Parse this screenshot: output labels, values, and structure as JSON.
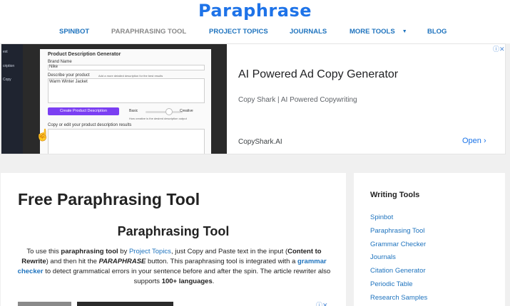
{
  "header": {
    "logo": "Paraphrase",
    "nav": [
      {
        "label": "SPINBOT"
      },
      {
        "label": "PARAPHRASING TOOL"
      },
      {
        "label": "PROJECT TOPICS"
      },
      {
        "label": "JOURNALS"
      },
      {
        "label": "MORE TOOLS"
      },
      {
        "label": "BLOG"
      }
    ]
  },
  "ad_banner": {
    "screenshot": {
      "sidebar_items": [
        "ext",
        "cription",
        "Copy"
      ],
      "panel_title": "Product Description Generator",
      "brand_label": "Brand Name",
      "brand_value": "Nike",
      "describe_label": "Describe your product",
      "describe_hint": "Add a more detailed description for the best results",
      "describe_value": "Warm Winter Jacket",
      "button_label": "Create Product Description",
      "basic_label": "Basic",
      "creative_label": "Creative",
      "slider_hint": "How creative is the desired description output",
      "output_label": "Copy or edit your product description results"
    },
    "title": "AI Powered Ad Copy Generator",
    "subtitle": "Copy Shark | AI Powered Copywriting",
    "domain": "CopyShark.AI",
    "open_label": "Open",
    "info_icon": "adchoices-info-close-icon"
  },
  "article": {
    "title": "Free Paraphrasing Tool",
    "heading": "Paraphrasing Tool",
    "intro": {
      "p1": "To use this ",
      "b1": "paraphrasing tool",
      "p2": " by ",
      "link1": "Project Topics",
      "p3": ", just Copy and Paste text in the input (",
      "b2": "Content to Rewrite",
      "p4": ") and then hit the ",
      "i1": "PARAPHRASE",
      "p5": " button. This paraphrasing tool is integrated with a ",
      "link2": "grammar checker",
      "p6": " to detect grammatical errors in your sentence before and after the spin. The article rewriter also supports ",
      "b3": "100+ languages",
      "p7": "."
    }
  },
  "sidebar": {
    "title": "Writing Tools",
    "links": [
      {
        "label": "Spinbot"
      },
      {
        "label": "Paraphrasing Tool"
      },
      {
        "label": "Grammar Checker"
      },
      {
        "label": "Journals"
      },
      {
        "label": "Citation Generator"
      },
      {
        "label": "Periodic Table"
      },
      {
        "label": "Research Samples"
      }
    ]
  },
  "colors": {
    "brand": "#1e73e8",
    "link": "#1e73be",
    "nav_active": "#888888",
    "ad_button": "#7b3ff2"
  }
}
